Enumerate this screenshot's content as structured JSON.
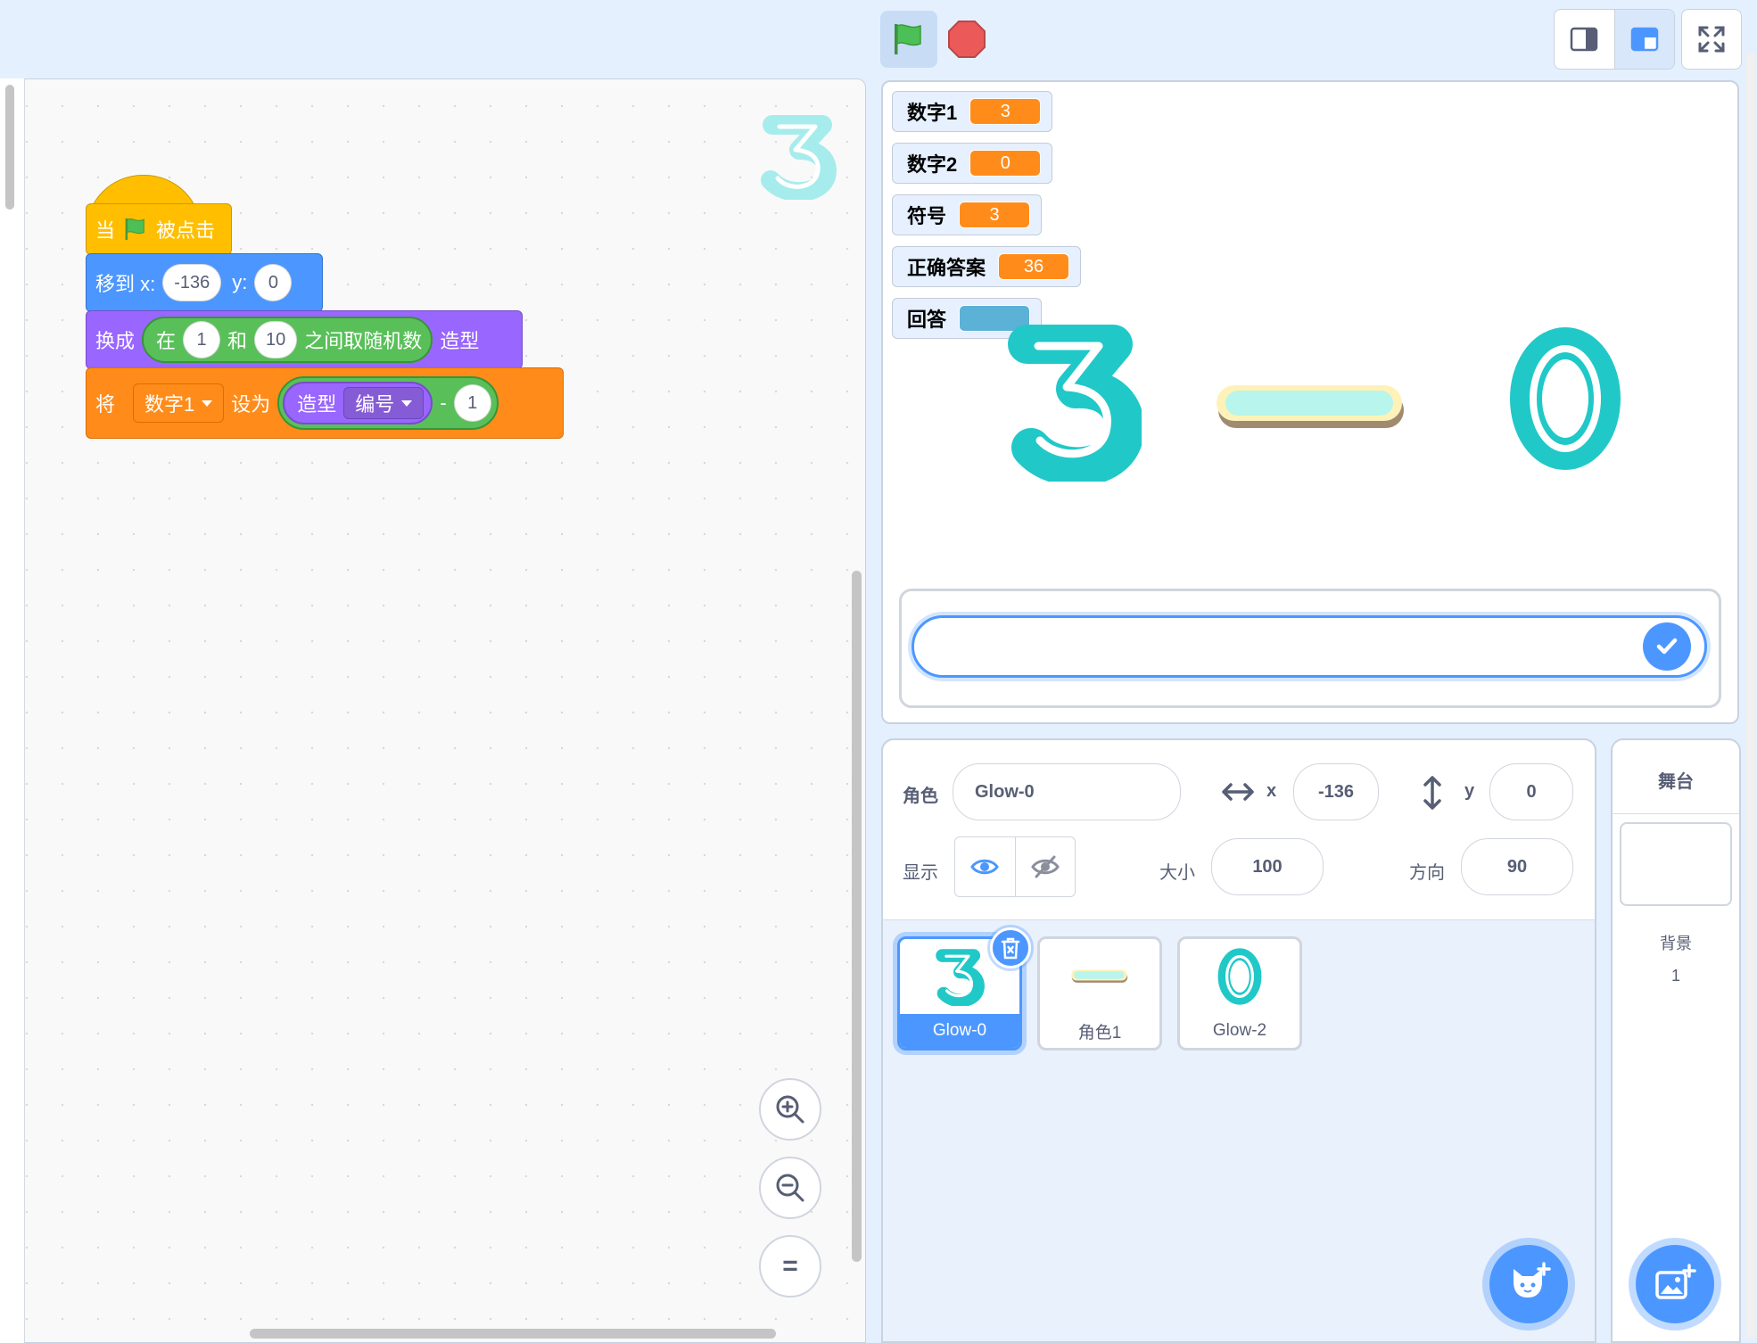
{
  "code": {
    "hat_block": {
      "prefix": "当",
      "suffix": "被点击"
    },
    "motion_block": {
      "label": "移到 x:",
      "x_value": "-136",
      "y_label": "y:",
      "y_value": "0"
    },
    "looks_block": {
      "label": "换成",
      "random_prefix": "在",
      "random_from": "1",
      "random_and": "和",
      "random_to": "10",
      "random_suffix": "之间取随机数",
      "suffix": "造型"
    },
    "data_block": {
      "label": "将",
      "variable": "数字1",
      "set_to": "设为",
      "costume_label": "造型",
      "costume_option": "编号",
      "minus": "-",
      "minus_value": "1"
    },
    "zoom": {
      "in": "+",
      "out": "−",
      "reset": "="
    }
  },
  "stage": {
    "monitors": [
      {
        "label": "数字1",
        "value": "3"
      },
      {
        "label": "数字2",
        "value": "0"
      },
      {
        "label": "符号",
        "value": "3"
      },
      {
        "label": "正确答案",
        "value": "36"
      },
      {
        "label": "回答",
        "value": ""
      }
    ],
    "ask_input": {
      "value": ""
    }
  },
  "sprite_info": {
    "sprite_label": "角色",
    "sprite_name": "Glow-0",
    "x_label": "x",
    "x_value": "-136",
    "y_label": "y",
    "y_value": "0",
    "show_label": "显示",
    "size_label": "大小",
    "size_value": "100",
    "direction_label": "方向",
    "direction_value": "90"
  },
  "sprites": [
    {
      "name": "Glow-0",
      "selected": true
    },
    {
      "name": "角色1",
      "selected": false
    },
    {
      "name": "Glow-2",
      "selected": false
    }
  ],
  "stage_selector": {
    "title": "舞台",
    "backdrop_label": "背景",
    "backdrop_count": "1"
  },
  "colors": {
    "accent": "#4c97ff",
    "events": "#ffbf00",
    "motion": "#4c97ff",
    "looks": "#9966ff",
    "operators": "#59c059",
    "variables": "#ff8c1a",
    "glow_teal": "#21c8c8"
  }
}
